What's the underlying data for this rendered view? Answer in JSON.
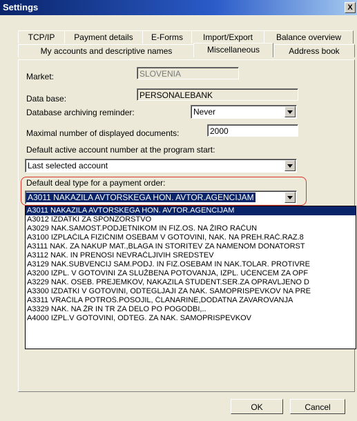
{
  "window": {
    "title": "Settings",
    "close_glyph": "X"
  },
  "tabs_row1": [
    {
      "label": "TCP/IP"
    },
    {
      "label": "Payment details"
    },
    {
      "label": "E-Forms"
    },
    {
      "label": "Import/Export"
    },
    {
      "label": "Balance overview"
    }
  ],
  "tabs_row2": [
    {
      "label": "My accounts and descriptive names"
    },
    {
      "label": "Miscellaneous",
      "active": true
    },
    {
      "label": "Address book"
    }
  ],
  "form": {
    "market": {
      "label": "Market:",
      "value": "SLOVENIA"
    },
    "database": {
      "label": "Data base:",
      "value": "PERSONALEBANK"
    },
    "archiving": {
      "label": "Database archiving reminder:",
      "value": "Never"
    },
    "max_docs": {
      "label": "Maximal number of displayed documents:",
      "value": "2000"
    },
    "default_account": {
      "label": "Default active account number at the program start:",
      "value": "Last selected account"
    },
    "deal_type": {
      "label": "Default deal type for a payment order:",
      "value": "A3011 NAKAZILA AVTORSKEGA HON. AVTOR.AGENCIJAM"
    }
  },
  "dropdown_options": [
    "A3011 NAKAZILA AVTORSKEGA HON. AVTOR.AGENCIJAM",
    "A3012 IZDATKI ZA SPONZORSTVO",
    "A3029 NAK.SAMOST.PODJETNIKOM IN FIZ.OS. NA ŽIRO RAČUN",
    "A3100 IZPLAČILA FIZIČNIM OSEBAM V GOTOVINI, NAK. NA PREH.RAČ.RAZ.8",
    "A3111 NAK. ZA NAKUP MAT.,BLAGA IN STORITEV ZA NAMENOM DONATORST",
    "A3112 NAK. IN PRENOSI NEVRAČLJIVIH SREDSTEV",
    "A3129 NAK.SUBVENCIJ SAM.PODJ. IN FIZ.OSEBAM IN NAK.TOLAR. PROTIVRE",
    "A3200 IZPL. V GOTOVINI ZA SLUŽBENA POTOVANJA, IZPL. UČENCEM ZA OPF",
    "A3229 NAK. OSEB. PREJEMKOV, NAKAZILA ŠTUDENT.SER.ZA OPRAVLJENO D",
    "A3300 IZDATKI V GOTOVINI, ODTEGLJAJI ZA NAK. SAMOPRISPEVKOV NA PRE",
    "A3311 VRAČILA POTROŠ.POSOJIL, ČLANARINE,DODATNA ZAVAROVANJA",
    "A3329 NAK. NA ŽR IN TR ZA DELO PO POGODBI,..",
    "A4000 IZPL.V GOTOVINI, ODTEG. ZA NAK. SAMOPRISPEVKOV"
  ],
  "buttons": {
    "ok": "OK",
    "cancel": "Cancel"
  }
}
